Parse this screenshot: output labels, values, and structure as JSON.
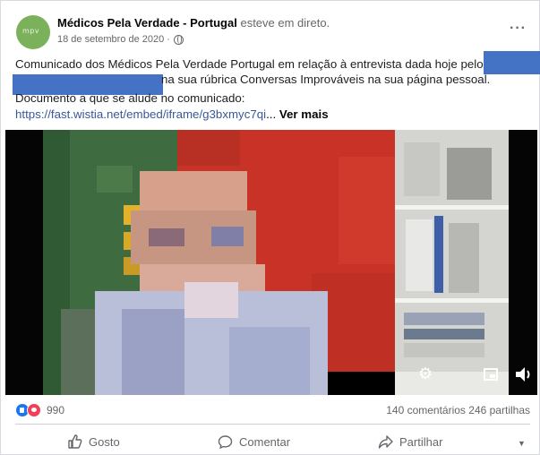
{
  "post": {
    "author": "Médicos Pela Verdade - Portugal",
    "author_suffix": "esteve em direto.",
    "date": "18 de setembro de 2020 ·",
    "more_label": "···",
    "text_line1": "Comunicado dos Médicos Pela Verdade Portugal em relação à entrevista dada hoje pelo",
    "text_line2": "na sua rúbrica Conversas Improváveis na sua página pessoal.",
    "text_line3": "Documento a que se alude no comunicado:",
    "link": "https://fast.wistia.net/embed/iframe/g3bxmyc7qi",
    "link_ellipsis": "...",
    "see_more": "Ver mais"
  },
  "video": {
    "controls": [
      "gear-icon",
      "picture-in-picture-icon",
      "volume-icon"
    ]
  },
  "stats": {
    "reaction_count": "990",
    "comments": "140 comentários",
    "shares": "246 partilhas"
  },
  "actions": {
    "like": "Gosto",
    "comment": "Comentar",
    "share": "Partilhar",
    "menu": "▼"
  },
  "colors": {
    "link": "#385898",
    "redaction": "#4472c4",
    "avatar": "#7ab15a",
    "like_blue": "#1877f2",
    "love_red": "#f33e58"
  }
}
